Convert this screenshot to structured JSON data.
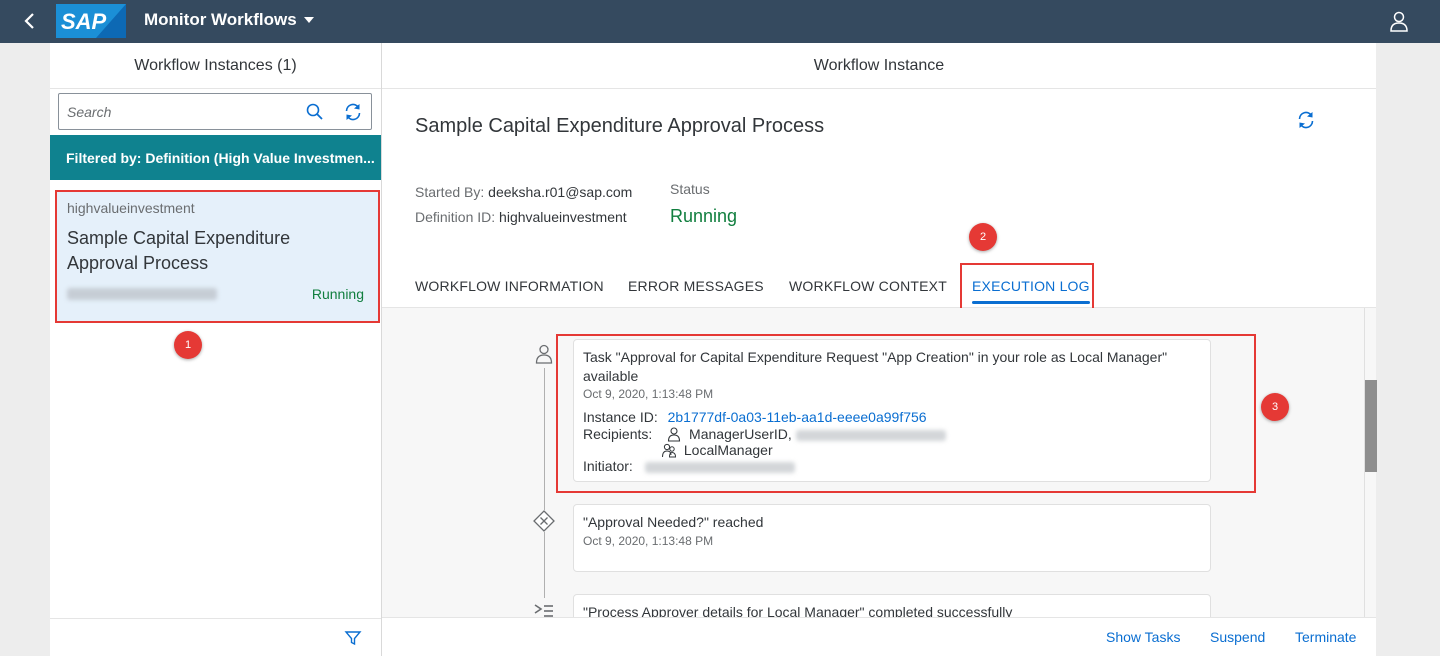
{
  "shell": {
    "logo_text": "SAP",
    "app_title": "Monitor Workflows",
    "icons": {
      "back": "back-arrow-icon",
      "dropdown": "chevron-down-icon",
      "user": "user-icon"
    }
  },
  "master": {
    "header": "Workflow Instances (1)",
    "search_placeholder": "Search",
    "filter_text": "Filtered by: Definition (High Value Investmen...",
    "items": [
      {
        "definition": "highvalueinvestment",
        "name": "Sample Capital Expenditure Approval Process",
        "status": "Running"
      }
    ]
  },
  "detail": {
    "header": "Workflow Instance",
    "title": "Sample Capital Expenditure Approval Process",
    "started_by_label": "Started By:",
    "started_by_value": "deeksha.r01@sap.com",
    "definition_label": "Definition ID:",
    "definition_value": "highvalueinvestment",
    "status_label": "Status",
    "status_value": "Running",
    "tabs": [
      "WORKFLOW INFORMATION",
      "ERROR MESSAGES",
      "WORKFLOW CONTEXT",
      "EXECUTION LOG"
    ],
    "active_tab": "EXECUTION LOG",
    "log": [
      {
        "text": "Task \"Approval for Capital Expenditure Request \"App Creation\" in your role as Local Manager\" available",
        "time": "Oct 9, 2020, 1:13:48 PM",
        "instance_label": "Instance ID:",
        "instance_id": "2b1777df-0a03-11eb-aa1d-eeee0a99f756",
        "recipients_label": "Recipients:",
        "recipient_user": "ManagerUserID,",
        "recipient_group": "LocalManager",
        "initiator_label": "Initiator:"
      },
      {
        "text": "\"Approval Needed?\" reached",
        "time": "Oct 9, 2020, 1:13:48 PM"
      },
      {
        "text": "\"Process Approver details for Local Manager\" completed successfully"
      }
    ],
    "footer": {
      "show_tasks": "Show Tasks",
      "suspend": "Suspend",
      "terminate": "Terminate"
    }
  },
  "markers": [
    "1",
    "2",
    "3"
  ],
  "colors": {
    "shell": "#354a5f",
    "filter_bar": "#0f828f",
    "accent": "#0a6ed1",
    "positive": "#107e3e",
    "highlight": "#e53935"
  }
}
